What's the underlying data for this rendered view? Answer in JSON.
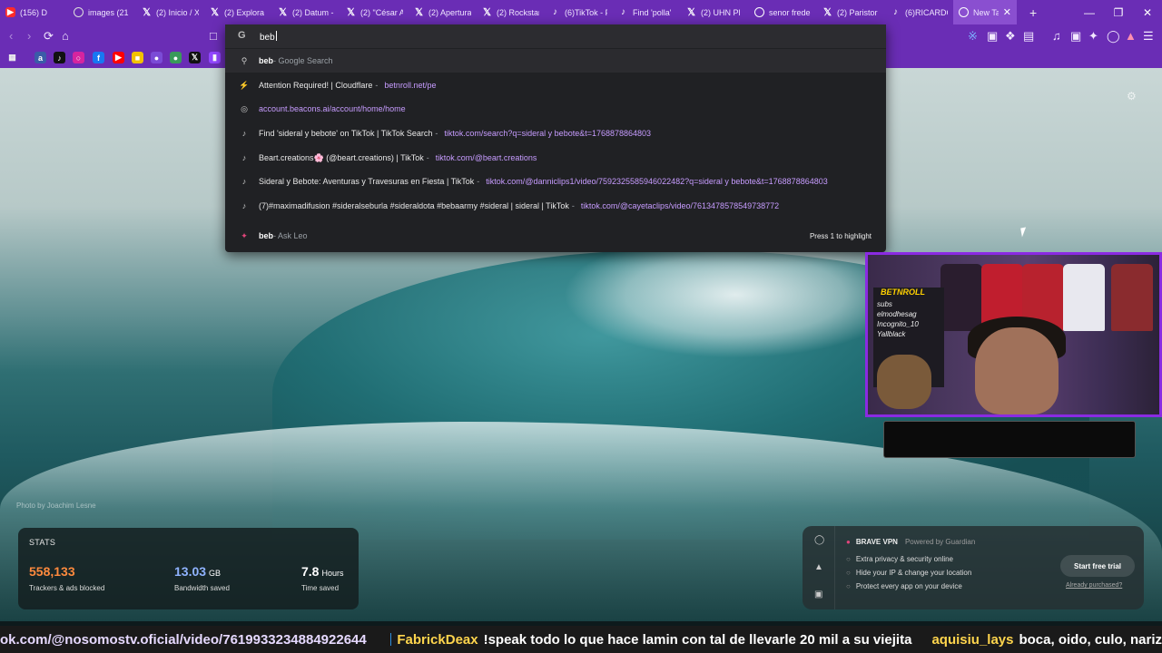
{
  "tabs": [
    {
      "title": "(156) D",
      "icon": "youtube-icon",
      "color": "#ff2a2a"
    },
    {
      "title": "images (21",
      "icon": "images-icon"
    },
    {
      "title": "(2) Inicio / X",
      "icon": "x-icon"
    },
    {
      "title": "(2) Explora",
      "icon": "x-icon"
    },
    {
      "title": "(2) Datum -",
      "icon": "x-icon"
    },
    {
      "title": "(2) \"César A",
      "icon": "x-icon"
    },
    {
      "title": "(2) Apertura",
      "icon": "x-icon"
    },
    {
      "title": "(2) Rockstar",
      "icon": "x-icon"
    },
    {
      "title": "(6)TikTok - F",
      "icon": "tiktok-icon"
    },
    {
      "title": "Find 'polla'",
      "icon": "tiktok-icon"
    },
    {
      "title": "(2) UHN Pl",
      "icon": "x-icon"
    },
    {
      "title": "senor frede",
      "icon": "google-icon"
    },
    {
      "title": "(2) Paristor",
      "icon": "x-icon"
    },
    {
      "title": "(6)RICARDO",
      "icon": "tiktok-icon"
    },
    {
      "title": "New Ta",
      "icon": "brave-icon",
      "active": true
    }
  ],
  "omnibox": {
    "query": "beb",
    "suggestions": [
      {
        "icon": "search-icon",
        "pre": "",
        "bold": "beb",
        "post": "",
        "dim": " - Google Search",
        "url": ""
      },
      {
        "icon": "cloudflare-icon",
        "pre": "Attention Required! | Cloudflare",
        "bold": "",
        "post": "",
        "dim": "",
        "url": "betnroll.net/pe"
      },
      {
        "icon": "globe-icon",
        "pre": "",
        "bold": "",
        "post": "",
        "dim": "",
        "url": "account.beacons.ai/account/home/home"
      },
      {
        "icon": "tiktok-icon",
        "pre": "Find 'sideral y bebote' on TikTok | TikTok Search",
        "bold": "",
        "post": "",
        "dim": "",
        "url": "tiktok.com/search?q=sideral y bebote&t=1768878864803"
      },
      {
        "icon": "tiktok-icon",
        "pre": "Beart.creations🌸 (@beart.creations) | TikTok",
        "bold": "",
        "post": "",
        "dim": "",
        "url": "tiktok.com/@beart.creations"
      },
      {
        "icon": "tiktok-icon",
        "pre": "Sideral y Bebote: Aventuras y Travesuras en Fiesta | TikTok",
        "bold": "",
        "post": "",
        "dim": "",
        "url": "tiktok.com/@danniclips1/video/7592325585946022482?q=sideral y bebote&t=1768878864803"
      },
      {
        "icon": "tiktok-icon",
        "pre": "(7)#maximadifusion #sideralseburla #sideraldota #bebaarmy #sideral | sideral | TikTok",
        "bold": "",
        "post": "",
        "dim": "",
        "url": "tiktok.com/@cayetaclips/video/7613478578549738772"
      },
      {
        "icon": "leo-icon",
        "pre": "",
        "bold": "beb",
        "post": "",
        "dim": " - Ask Leo",
        "url": "",
        "hint": "Press 1 to highlight"
      }
    ]
  },
  "background": {
    "photo_credit": "Photo by Joachim Lesne"
  },
  "stats": {
    "label": "STATS",
    "items": [
      {
        "value": "558,133",
        "unit": "",
        "desc": "Trackers & ads blocked",
        "color": "#ff8a3d"
      },
      {
        "value": "13.03",
        "unit": "GB",
        "desc": "Bandwidth saved",
        "color": "#8fb3ff"
      },
      {
        "value": "7.8",
        "unit": "Hours",
        "desc": "Time saved",
        "color": "#ffffff"
      }
    ]
  },
  "vpn": {
    "title": "BRAVE VPN",
    "powered": "Powered by Guardian",
    "features": [
      "Extra privacy & security online",
      "Hide your IP & change your location",
      "Protect every app on your device"
    ],
    "cta": "Start free trial",
    "already": "Already purchased?"
  },
  "webcam": {
    "logo": "BETNROLL",
    "board_lines": [
      "subs",
      "elmodhesag",
      "Incognito_10",
      "Yallblack"
    ]
  },
  "ticker": {
    "text1": "ok.com/@nosomostv.oficial/video/7619933234884922644",
    "user1": "FabrickDeax",
    "msg1": "!speak todo lo que hace lamin con tal de llevarle 20 mil a su viejita",
    "user2": "aquisiu_lays",
    "msg2": "boca, oido, culo, nariz"
  }
}
